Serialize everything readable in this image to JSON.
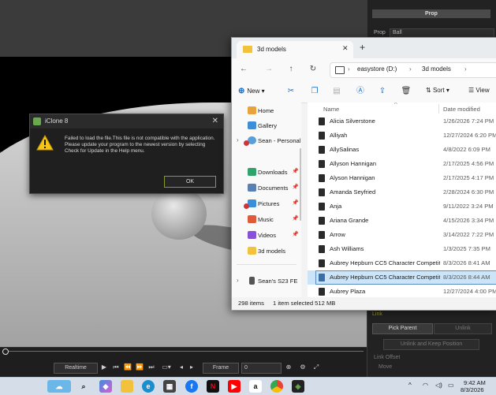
{
  "iclone": {
    "dialog": {
      "title": "iClone 8",
      "message": "Failed to load the file.This file is not compatible with the application. Please update your program to the newest version by selecting Check for Update in the Help menu.",
      "ok_label": "OK",
      "close_glyph": "✕"
    },
    "timeline": {
      "mode": "Realtime",
      "frame_label": "Frame",
      "frame_value": "0"
    },
    "props_panel": {
      "header": "Prop",
      "prop_label": "Prop",
      "prop_value": "Ball",
      "link_label": "Link",
      "pick_parent": "Pick Parent",
      "unlink": "Unlink",
      "unlink_keep": "Unlink and Keep Position",
      "link_offset": "Link Offset",
      "move": "Move"
    }
  },
  "explorer": {
    "tab_title": "3d models",
    "breadcrumb": [
      "easystore (D:)",
      "3d models"
    ],
    "toolbar": {
      "new_label": "New",
      "sort_label": "Sort",
      "view_label": "View"
    },
    "nav": [
      {
        "label": "Home",
        "icon": "home-icon",
        "color": "#e8a33d"
      },
      {
        "label": "Gallery",
        "icon": "gallery-icon",
        "color": "#3a8fd8"
      },
      {
        "label": "Sean - Personal",
        "icon": "onedrive-icon",
        "color": "#5a9fd8"
      },
      {
        "label": "Downloads",
        "icon": "downloads-icon",
        "color": "#2fa36b"
      },
      {
        "label": "Documents",
        "icon": "documents-icon",
        "color": "#5a7fb5"
      },
      {
        "label": "Pictures",
        "icon": "pictures-icon",
        "color": "#3a8fd8"
      },
      {
        "label": "Music",
        "icon": "music-icon",
        "color": "#e05a3a"
      },
      {
        "label": "Videos",
        "icon": "videos-icon",
        "color": "#8a4fd8"
      },
      {
        "label": "3d models",
        "icon": "folder-icon",
        "color": "#f2c23d"
      },
      {
        "label": "Sean's S23 FE",
        "icon": "phone-icon",
        "color": "#555555"
      }
    ],
    "columns": {
      "name": "Name",
      "date": "Date modified"
    },
    "files": [
      {
        "name": "Alicia Silverstone",
        "date": "1/26/2026 7:24 PM"
      },
      {
        "name": "Alliyah",
        "date": "12/27/2024 6:20 PM"
      },
      {
        "name": "AllySalinas",
        "date": "4/8/2022 6:09 PM"
      },
      {
        "name": "Allyson Hannigan",
        "date": "2/17/2025 4:56 PM"
      },
      {
        "name": "Alyson Hannigan",
        "date": "2/17/2025 4:17 PM"
      },
      {
        "name": "Amanda Seyfried",
        "date": "2/28/2024 6:30 PM"
      },
      {
        "name": "Anja",
        "date": "9/11/2022 3:24 PM"
      },
      {
        "name": "Ariana Grande",
        "date": "4/15/2026 3:34 PM"
      },
      {
        "name": "Arrow",
        "date": "3/14/2022 7:22 PM"
      },
      {
        "name": "Ash Williams",
        "date": "1/3/2025 7:35 PM"
      },
      {
        "name": "Aubrey Hepburn CC5 Character Competit...",
        "date": "8/3/2026 8:41 AM"
      },
      {
        "name": "Aubrey Hepburn CC5 Character Competit...",
        "date": "8/3/2026 8:44 AM",
        "selected": true
      },
      {
        "name": "Aubrey Plaza",
        "date": "12/27/2024 4:00 PM"
      }
    ],
    "status": {
      "count": "298 items",
      "selection": "1 item selected  512 MB"
    }
  },
  "taskbar": {
    "time": "9:42 AM",
    "date": "8/3/2026",
    "apps": [
      "widgets",
      "search",
      "copilot",
      "file-explorer",
      "edge",
      "store",
      "facebook",
      "netflix",
      "youtube",
      "amazon",
      "chrome",
      "iclone"
    ]
  }
}
